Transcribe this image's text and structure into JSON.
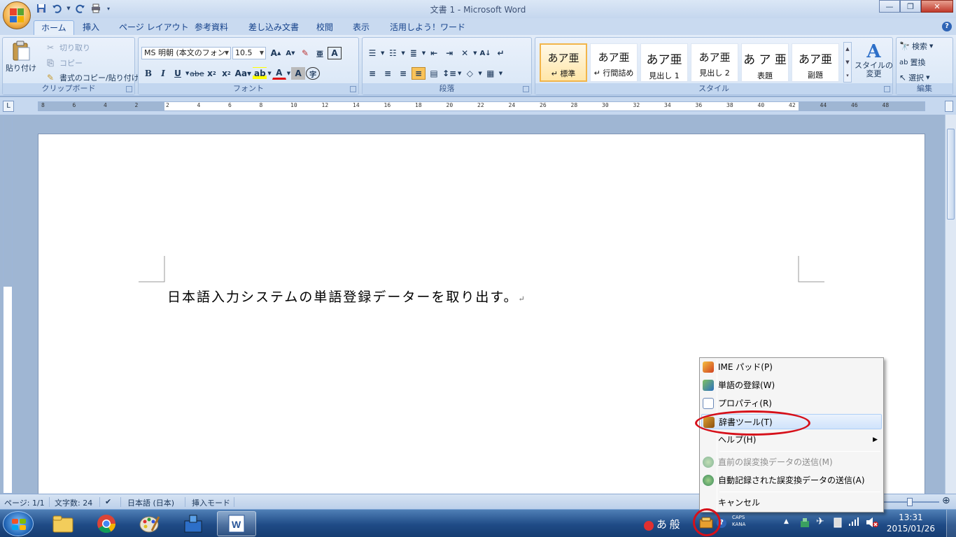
{
  "window": {
    "title": "文書 1 - Microsoft Word",
    "minimize": "—",
    "maximize": "❐",
    "close": "✕"
  },
  "quick_access": {
    "save_icon": "save-icon",
    "undo_icon": "undo-icon",
    "redo_icon": "redo-icon",
    "print_icon": "print-icon"
  },
  "tabs": [
    "ホーム",
    "挿入",
    "ページ レイアウト",
    "参考資料",
    "差し込み文書",
    "校閲",
    "表示",
    "活用しよう！ワード"
  ],
  "active_tab": "ホーム",
  "ribbon": {
    "clipboard": {
      "paste": "貼り付け",
      "cut": "切り取り",
      "copy": "コピー",
      "format_painter": "書式のコピー/貼り付け",
      "label": "クリップボード"
    },
    "font": {
      "font_name": "MS 明朝 (本文のフォン",
      "font_size": "10.5",
      "label": "フォント"
    },
    "paragraph": {
      "label": "段落"
    },
    "styles": {
      "label": "スタイル",
      "tiles": [
        {
          "sample": "あア亜",
          "name": "↵ 標準"
        },
        {
          "sample": "あア亜",
          "name": "↵ 行間詰め"
        },
        {
          "sample": "あア亜",
          "name": "見出し 1"
        },
        {
          "sample": "あア亜",
          "name": "見出し 2"
        },
        {
          "sample": "あ ア 亜",
          "name": "表題"
        },
        {
          "sample": "あア亜",
          "name": "副題"
        }
      ],
      "change_styles_line1": "スタイルの",
      "change_styles_line2": "変更"
    },
    "editing": {
      "find": "検索",
      "replace": "置換",
      "select": "選択",
      "label": "編集"
    }
  },
  "ruler": {
    "numbers": [
      "8",
      "6",
      "4",
      "2",
      "2",
      "4",
      "6",
      "8",
      "10",
      "12",
      "14",
      "16",
      "18",
      "20",
      "22",
      "24",
      "26",
      "28",
      "30",
      "32",
      "34",
      "36",
      "38",
      "40",
      "42",
      "44",
      "46",
      "48"
    ]
  },
  "document": {
    "text": "日本語入力システムの単語登録データーを取り出す。",
    "para_mark": "↵"
  },
  "statusbar": {
    "page": "ページ: 1/1",
    "word_count": "文字数: 24",
    "language": "日本語 (日本)",
    "mode": "挿入モード"
  },
  "context_menu": {
    "items": [
      {
        "label": "IME パッド(P)",
        "icon": "ime-pad-icon",
        "enabled": true
      },
      {
        "label": "単語の登録(W)",
        "icon": "word-register-icon",
        "enabled": true
      },
      {
        "label": "プロパティ(R)",
        "icon": "properties-icon",
        "enabled": true
      },
      {
        "label": "辞書ツール(T)",
        "icon": "dictionary-tool-icon",
        "enabled": true,
        "highlighted": true
      },
      {
        "label": "ヘルプ(H)",
        "icon": "",
        "enabled": true,
        "submenu": true
      },
      {
        "label": "直前の誤変換データの送信(M)",
        "icon": "send-data-icon",
        "enabled": false
      },
      {
        "label": "自動記録された誤変換データの送信(A)",
        "icon": "send-data-icon",
        "enabled": true
      },
      {
        "label": "キャンセル",
        "icon": "",
        "enabled": true
      }
    ]
  },
  "taskbar": {
    "ime_mode": "あ",
    "ime_conv": "般",
    "caps": "CAPS",
    "kana": "KANA",
    "time": "13:31",
    "date": "2015/01/26"
  },
  "colors": {
    "annotation": "#d6101a",
    "menu_highlight": "#d0e3fb"
  }
}
